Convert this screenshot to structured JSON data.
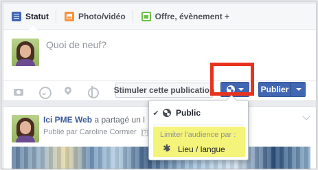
{
  "composer": {
    "tabs": [
      {
        "label": "Statut"
      },
      {
        "label": "Photo/vidéo"
      },
      {
        "label": "Offre, évènement +"
      }
    ],
    "placeholder": "Quoi de neuf?",
    "boost_label": "Stimuler cette publication",
    "publish_label": "Publier"
  },
  "post": {
    "page_name": "Ici PME Web",
    "action": "a partagé un l",
    "published_by": "Publié par Caroline Cormier",
    "help_badge": "[?]"
  },
  "audience_menu": {
    "selected": "Public",
    "limit_label": "Limiter l'audience par :",
    "location_option": "Lieu / langue"
  },
  "colors": {
    "brand_blue": "#4267b2",
    "highlight_red": "#e8321e",
    "highlight_yellow": "#f4f37a"
  },
  "icons": [
    "status-icon",
    "photo-icon",
    "event-icon",
    "camera-icon",
    "smiley-icon",
    "location-pin-icon",
    "target-icon",
    "globe-icon",
    "chevron-down-icon",
    "check-icon",
    "gear-icon"
  ]
}
